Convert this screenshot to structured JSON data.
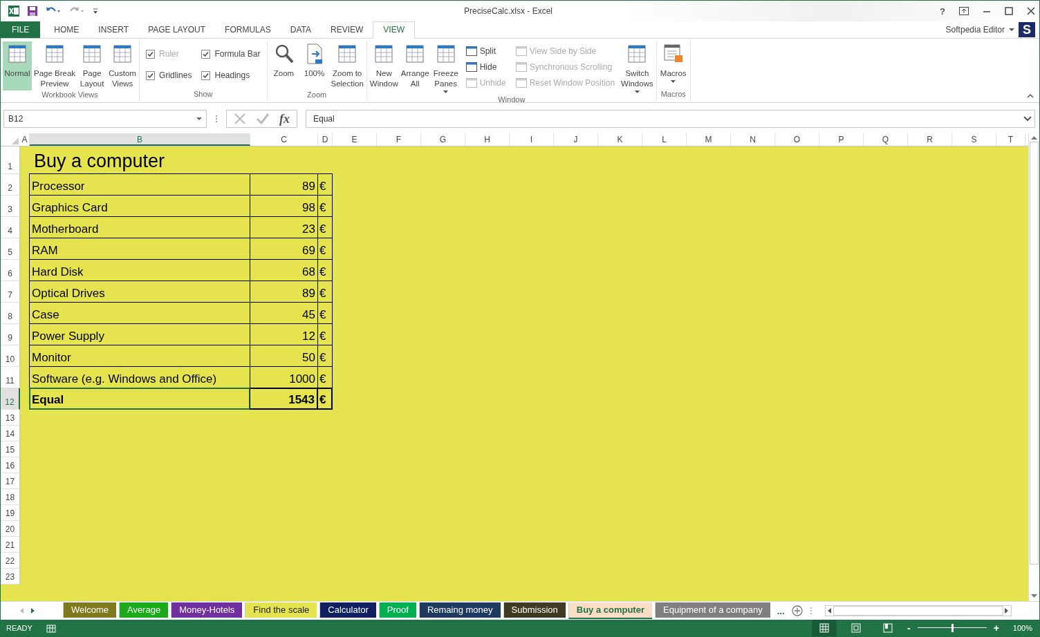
{
  "window": {
    "title": "PreciseCalc.xlsx - Excel",
    "help": "?",
    "user": "Softpedia Editor",
    "avatar": "S"
  },
  "ribbon": {
    "tabs": [
      {
        "label": "FILE",
        "kind": "file",
        "selected": false
      },
      {
        "label": "HOME",
        "kind": "tab",
        "selected": false
      },
      {
        "label": "INSERT",
        "kind": "tab",
        "selected": false
      },
      {
        "label": "PAGE LAYOUT",
        "kind": "tab",
        "selected": false
      },
      {
        "label": "FORMULAS",
        "kind": "tab",
        "selected": false
      },
      {
        "label": "DATA",
        "kind": "tab",
        "selected": false
      },
      {
        "label": "REVIEW",
        "kind": "tab",
        "selected": false
      },
      {
        "label": "VIEW",
        "kind": "tab",
        "selected": true
      }
    ],
    "groups": [
      {
        "label": "Workbook Views",
        "items": [
          {
            "kind": "large",
            "lines": [
              "Normal"
            ],
            "selected": true
          },
          {
            "kind": "large",
            "lines": [
              "Page Break",
              "Preview"
            ],
            "selected": false
          },
          {
            "kind": "large",
            "lines": [
              "Page",
              "Layout"
            ],
            "selected": false
          },
          {
            "kind": "large",
            "lines": [
              "Custom",
              "Views"
            ],
            "selected": false
          }
        ]
      },
      {
        "label": "Show",
        "items": [
          {
            "kind": "stack",
            "items": [
              {
                "kind": "checkbox",
                "label": "Ruler",
                "checked": true,
                "disabled": true
              },
              {
                "kind": "checkbox",
                "label": "Gridlines",
                "checked": true,
                "disabled": false
              }
            ]
          },
          {
            "kind": "stack",
            "items": [
              {
                "kind": "checkbox",
                "label": "Formula Bar",
                "checked": true,
                "disabled": false
              },
              {
                "kind": "checkbox",
                "label": "Headings",
                "checked": true,
                "disabled": false
              }
            ]
          }
        ]
      },
      {
        "label": "Zoom",
        "items": [
          {
            "kind": "large",
            "lines": [
              "Zoom"
            ]
          },
          {
            "kind": "large",
            "lines": [
              "100%"
            ]
          },
          {
            "kind": "large",
            "lines": [
              "Zoom to",
              "Selection"
            ]
          }
        ]
      },
      {
        "label": "Window",
        "items": [
          {
            "kind": "large",
            "lines": [
              "New",
              "Window"
            ]
          },
          {
            "kind": "large",
            "lines": [
              "Arrange",
              "All"
            ]
          },
          {
            "kind": "large",
            "lines": [
              "Freeze",
              "Panes"
            ],
            "dropdown": true
          },
          {
            "kind": "stack",
            "items": [
              {
                "kind": "small",
                "label": "Split",
                "disabled": false
              },
              {
                "kind": "small",
                "label": "Hide",
                "disabled": false
              },
              {
                "kind": "small",
                "label": "Unhide",
                "disabled": true
              }
            ]
          },
          {
            "kind": "stack",
            "items": [
              {
                "kind": "small",
                "label": "View Side by Side",
                "disabled": true
              },
              {
                "kind": "small",
                "label": "Synchronous Scrolling",
                "disabled": true
              },
              {
                "kind": "small",
                "label": "Reset Window Position",
                "disabled": true
              }
            ]
          },
          {
            "kind": "large",
            "lines": [
              "Switch",
              "Windows"
            ],
            "dropdown": true
          }
        ]
      },
      {
        "label": "Macros",
        "items": [
          {
            "kind": "large",
            "lines": [
              "Macros"
            ],
            "dropdown": true
          }
        ]
      }
    ]
  },
  "formula_bar": {
    "name_box": "B12",
    "fx": "fx",
    "value": "Equal"
  },
  "columns": [
    {
      "label": "A",
      "selected": false
    },
    {
      "label": "B",
      "selected": true
    },
    {
      "label": "C",
      "selected": false
    },
    {
      "label": "D",
      "selected": false
    },
    {
      "label": "E",
      "selected": false
    },
    {
      "label": "F",
      "selected": false
    },
    {
      "label": "G",
      "selected": false
    },
    {
      "label": "H",
      "selected": false
    },
    {
      "label": "I",
      "selected": false
    },
    {
      "label": "J",
      "selected": false
    },
    {
      "label": "K",
      "selected": false
    },
    {
      "label": "L",
      "selected": false
    },
    {
      "label": "M",
      "selected": false
    },
    {
      "label": "N",
      "selected": false
    },
    {
      "label": "O",
      "selected": false
    },
    {
      "label": "P",
      "selected": false
    },
    {
      "label": "Q",
      "selected": false
    },
    {
      "label": "R",
      "selected": false
    },
    {
      "label": "S",
      "selected": false
    },
    {
      "label": "T",
      "selected": false
    }
  ],
  "rows": [
    {
      "label": "1",
      "selected": false
    },
    {
      "label": "2",
      "selected": false
    },
    {
      "label": "3",
      "selected": false
    },
    {
      "label": "4",
      "selected": false
    },
    {
      "label": "5",
      "selected": false
    },
    {
      "label": "6",
      "selected": false
    },
    {
      "label": "7",
      "selected": false
    },
    {
      "label": "8",
      "selected": false
    },
    {
      "label": "9",
      "selected": false
    },
    {
      "label": "10",
      "selected": false
    },
    {
      "label": "11",
      "selected": false
    },
    {
      "label": "12",
      "selected": true
    },
    {
      "label": "13",
      "selected": false
    },
    {
      "label": "14",
      "selected": false
    },
    {
      "label": "15",
      "selected": false
    },
    {
      "label": "16",
      "selected": false
    },
    {
      "label": "17",
      "selected": false
    },
    {
      "label": "18",
      "selected": false
    },
    {
      "label": "19",
      "selected": false
    },
    {
      "label": "20",
      "selected": false
    },
    {
      "label": "21",
      "selected": false
    },
    {
      "label": "22",
      "selected": false
    },
    {
      "label": "23",
      "selected": false
    }
  ],
  "sheet": {
    "title": "Buy a computer",
    "items": [
      {
        "kind": "item",
        "label": "Processor",
        "amount": "89",
        "currency": "€",
        "selected": false
      },
      {
        "kind": "item",
        "label": "Graphics Card",
        "amount": "98",
        "currency": "€",
        "selected": false
      },
      {
        "kind": "item",
        "label": "Motherboard",
        "amount": "23",
        "currency": "€",
        "selected": false
      },
      {
        "kind": "item",
        "label": "RAM",
        "amount": "69",
        "currency": "€",
        "selected": false
      },
      {
        "kind": "item",
        "label": "Hard Disk",
        "amount": "68",
        "currency": "€",
        "selected": false
      },
      {
        "kind": "item",
        "label": "Optical Drives",
        "amount": "89",
        "currency": "€",
        "selected": false
      },
      {
        "kind": "item",
        "label": "Case",
        "amount": "45",
        "currency": "€",
        "selected": false
      },
      {
        "kind": "item",
        "label": "Power Supply",
        "amount": "12",
        "currency": "€",
        "selected": false
      },
      {
        "kind": "item",
        "label": "Monitor",
        "amount": "50",
        "currency": "€",
        "selected": false
      },
      {
        "kind": "item",
        "label": "Software (e.g. Windows and Office)",
        "amount": "1000",
        "currency": "€",
        "selected": false
      },
      {
        "kind": "total",
        "label": "Equal",
        "amount": "1543",
        "currency": "€",
        "selected": true
      }
    ]
  },
  "sheet_tabs": {
    "tabs": [
      {
        "label": "Welcome",
        "color": "#7f7a1e",
        "selected": false
      },
      {
        "label": "Average",
        "color": "#1aaa1a",
        "selected": false
      },
      {
        "label": "Money-Hotels",
        "color": "#7030a0",
        "selected": false
      },
      {
        "label": "Find the scale",
        "color": "#e6e44e",
        "selected": false
      },
      {
        "label": "Calculator",
        "color": "#0f1f5f",
        "selected": false
      },
      {
        "label": "Proof",
        "color": "#00b050",
        "selected": false
      },
      {
        "label": "Remaing money",
        "color": "#1f3a5f",
        "selected": false
      },
      {
        "label": "Submission",
        "color": "#3f3a22",
        "selected": false
      },
      {
        "label": "Buy a computer",
        "color": "#fbdcc4",
        "selected": true
      },
      {
        "label": "Equipment of a company",
        "color": "#7f7f7f",
        "selected": false
      }
    ],
    "more": "..."
  },
  "status_bar": {
    "status": "READY",
    "views": [
      {
        "selected": true
      },
      {
        "selected": false
      },
      {
        "selected": false
      }
    ],
    "zoom_out": "-",
    "zoom": {
      "level": 0.5
    },
    "zoom_in": "+",
    "zoom_label": "100%"
  }
}
